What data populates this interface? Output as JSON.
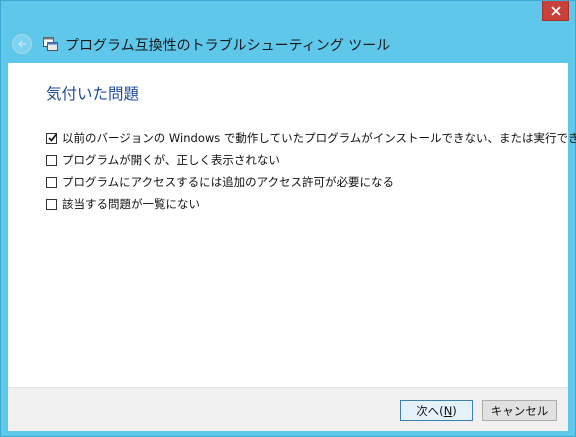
{
  "window": {
    "title": "プログラム互換性のトラブルシューティング ツール"
  },
  "heading": "気付いた問題",
  "options": [
    {
      "label": "以前のバージョンの Windows で動作していたプログラムがインストールできない、または実行できない",
      "checked": true
    },
    {
      "label": "プログラムが開くが、正しく表示されない",
      "checked": false
    },
    {
      "label": "プログラムにアクセスするには追加のアクセス許可が必要になる",
      "checked": false
    },
    {
      "label": "該当する問題が一覧にない",
      "checked": false
    }
  ],
  "buttons": {
    "next_label": "次へ(N)",
    "next_prefix": "次へ(",
    "next_mnemonic": "N",
    "next_suffix": ")",
    "cancel_label": "キャンセル"
  },
  "icons": {
    "close": "close-icon",
    "back": "back-arrow-icon",
    "app": "compatibility-wizard-icon",
    "check": "checkmark-icon"
  },
  "colors": {
    "titlebar": "#5fc7ea",
    "close_button": "#c7403a",
    "heading": "#1e4a9c",
    "footer": "#f0f0f0"
  }
}
